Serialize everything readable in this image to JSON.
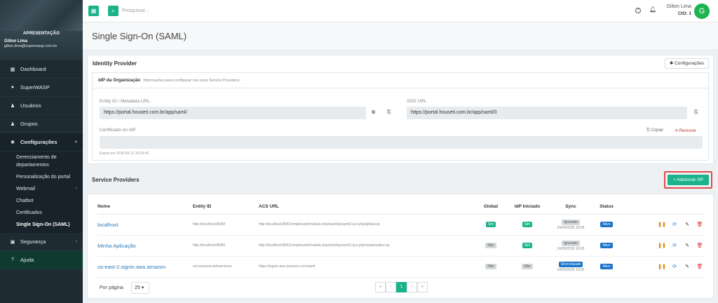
{
  "sidebar": {
    "role": "APRESENTAÇÃO",
    "user_name": "Gilton Lima",
    "user_email": "gilton.lima@superwasp.com.br",
    "items": [
      {
        "label": "Dashboard",
        "icon": "grid-icon"
      },
      {
        "label": "SuperWASP",
        "icon": "chat-icon"
      },
      {
        "label": "Usuários",
        "icon": "user-icon"
      },
      {
        "label": "Grupos",
        "icon": "users-icon"
      },
      {
        "label": "Configurações",
        "icon": "gear-icon"
      }
    ],
    "sub_items": [
      "Gerenciamento de departamentos",
      "Personalização do portal",
      "Webmail",
      "Chatbot",
      "Certificados",
      "Single Sign-On (SAML)"
    ],
    "security": "Segurança",
    "help": "Ajuda"
  },
  "topbar": {
    "search_placeholder": "Pesquisar...",
    "user_name": "Gilton Lima",
    "user_sub": "CIO: 1",
    "avatar_letter": "G"
  },
  "page": {
    "title": "Single Sign-On (SAML)"
  },
  "idp": {
    "title": "Identity Provider",
    "config_button": "Configurações",
    "section_title": "IdP da Organização",
    "section_hint": "Informações para configurar nos seus Service Providers.",
    "entity_label": "Entity ID / Metadata URL",
    "entity_value": "https://portal.houseti.com.br/app/saml/",
    "sso_label": "SSO URL",
    "sso_value": "https://portal.houseti.com.br/app/saml/0",
    "cert_label": "Certificado do IdP",
    "copy_label": "Copiar",
    "remove_label": "Remover",
    "expiry": "Expira em 2036-09-12 14:29:45"
  },
  "sp": {
    "title": "Service Providers",
    "add_button": "Adicionar SP",
    "columns": [
      "Nome",
      "Entity ID",
      "ACS URL",
      "Global",
      "IdP Iniciado",
      "Sync",
      "Status"
    ],
    "rows": [
      {
        "name": "localhost",
        "entity": "http://localhost:8080/",
        "acs": "http://localhost:8081/simplesaml/module.php/saml/sp/saml2-acs.php/global-sp",
        "global": "Sim",
        "idp": "Sim",
        "sync": "Ignorado",
        "sync_date": "24/09/2026 10:00",
        "status": "Ativo"
      },
      {
        "name": "Minha Aplicação",
        "entity": "http://localhost:8080/",
        "acs": "http://localhost:8081/simplesaml/module.php/saml/sp/saml2-acs.php/organization-sp",
        "global": "Não",
        "idp": "Sim",
        "sync": "Ignorado",
        "sync_date": "24/09/2026 10:00",
        "status": "Ativo"
      },
      {
        "name": "us-east-2.signin.aws.amazon",
        "entity": "urn:amazon:webservices",
        "acs": "https://signin.aws.amazon.com/saml",
        "global": "Não",
        "idp": "Não",
        "sync": "Sincronizado",
        "sync_date": "24/09/2026 10:00",
        "status": "Ativo"
      }
    ],
    "per_page_label": "Por página",
    "per_page_value": "25",
    "current_page": "1"
  },
  "colors": {
    "accent": "#1db38a",
    "sidebar": "#1f2b33",
    "link": "#2a7ab8",
    "highlight": "#e24b4b"
  }
}
